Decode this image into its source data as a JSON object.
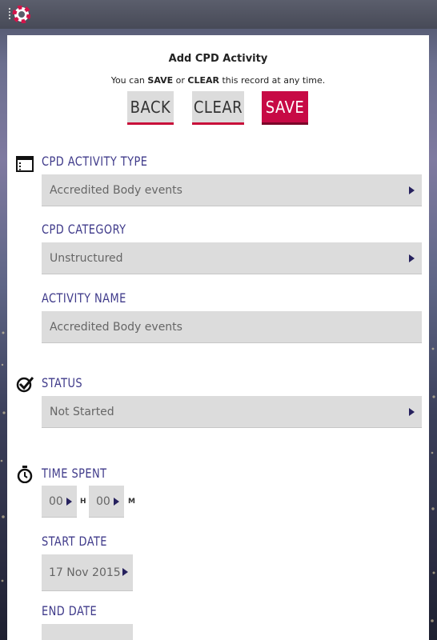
{
  "header": {
    "logo": "lifebuoy-logo-icon"
  },
  "form": {
    "title": "Add CPD Activity",
    "subtitle": {
      "pre": "You can ",
      "save": "SAVE",
      "mid": " or ",
      "clear": "CLEAR",
      "post": " this record at any time."
    },
    "buttons": {
      "back": "BACK",
      "clear": "CLEAR",
      "save": "SAVE"
    },
    "activity_type": {
      "label": "CPD ACTIVITY TYPE",
      "value": "Accredited Body events",
      "icon": "calendar-icon"
    },
    "category": {
      "label": "CPD CATEGORY",
      "value": "Unstructured"
    },
    "activity_name": {
      "label": "ACTIVITY NAME",
      "value": "Accredited Body events"
    },
    "status": {
      "label": "STATUS",
      "value": "Not Started",
      "icon": "check-icon"
    },
    "time_spent": {
      "label": "TIME SPENT",
      "hours": "00",
      "hours_unit": "H",
      "minutes": "00",
      "minutes_unit": "M",
      "icon": "stopwatch-icon"
    },
    "start_date": {
      "label": "START DATE",
      "value": "17 Nov 2015"
    },
    "end_date": {
      "label": "END DATE"
    }
  },
  "colors": {
    "accent": "#c70a45",
    "label": "#3f3a8a",
    "field_bg": "#dcdcdc"
  }
}
